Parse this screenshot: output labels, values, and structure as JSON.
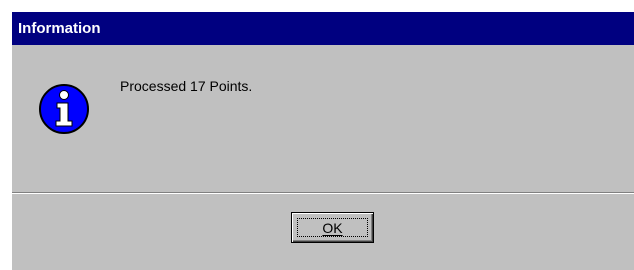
{
  "window": {
    "title": "Information",
    "title_bar_color": "#000080",
    "background_color": "#c0c0c0"
  },
  "dialog": {
    "icon": "information-icon",
    "icon_color": "#0000ff",
    "message": "Processed 17 Points."
  },
  "buttons": {
    "ok_label": "OK",
    "ok_accelerator": "O"
  }
}
